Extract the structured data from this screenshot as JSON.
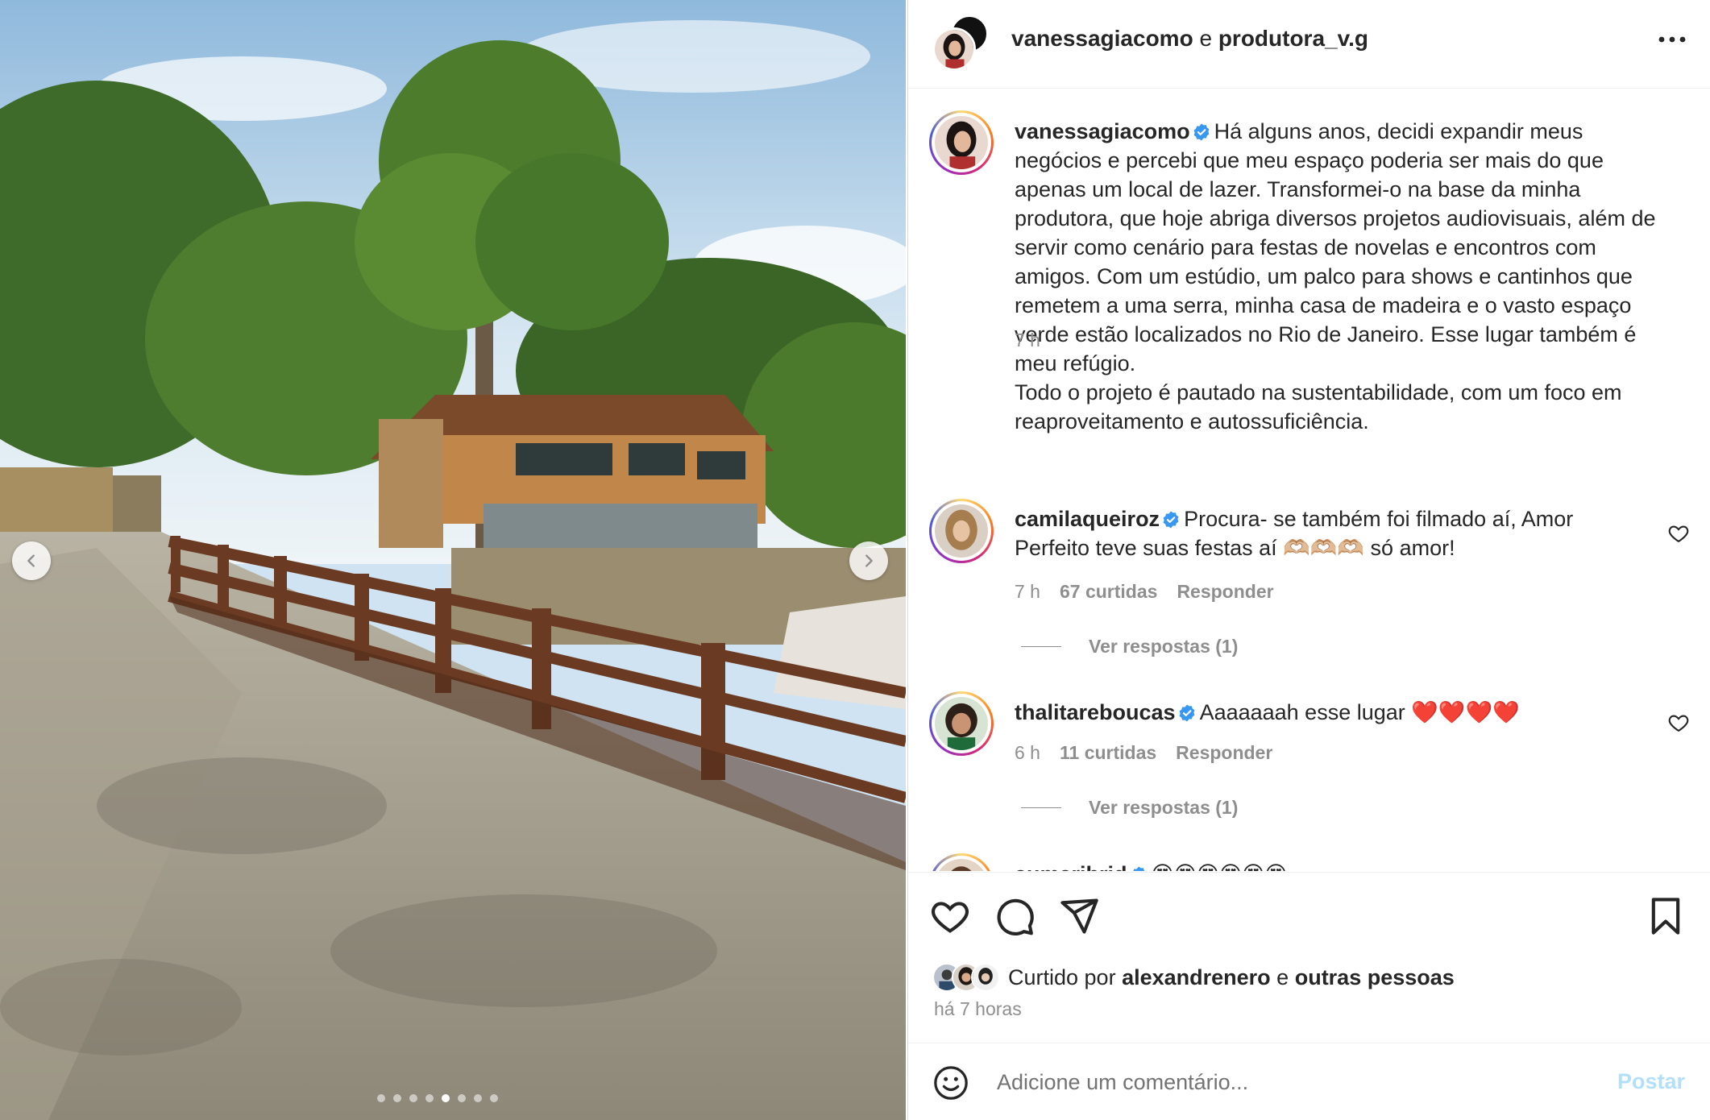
{
  "media": {
    "slide_count": 8,
    "active_slide": 5
  },
  "header": {
    "user1": "vanessagiacomo",
    "connector": " e ",
    "user2": "produtora_v.g"
  },
  "caption": {
    "username": "vanessagiacomo",
    "text": "Há alguns anos, decidi expandir meus negócios e percebi que meu espaço poderia ser mais do que apenas um local de lazer. Transformei-o na base da minha produtora, que hoje abriga diversos projetos audiovisuais, além de servir como cenário para festas de novelas e encontros com amigos. Com um estúdio, um palco para shows e cantinhos que remetem a uma serra, minha casa de madeira e o vasto espaço verde estão localizados no Rio de Janeiro. Esse lugar também é meu refúgio.",
    "text2": "Todo o projeto é pautado na sustentabilidade, com um foco em reaproveitamento e autossuficiência.",
    "time": "7 h"
  },
  "comments": [
    {
      "username": "camilaqueiroz",
      "text_a": "Procura- se também foi filmado aí, Amor Perfeito teve suas festas aí ",
      "emoji": "🫶🏼🫶🏼🫶🏼",
      "text_b": " só amor!",
      "time": "7 h",
      "likes": "67 curtidas",
      "reply": "Responder",
      "view_replies": "Ver respostas (1)"
    },
    {
      "username": "thalitareboucas",
      "text_a": "Aaaaaaah esse lugar ",
      "emoji": "❤️❤️❤️❤️",
      "time": "6 h",
      "likes": "11 curtidas",
      "reply": "Responder",
      "view_replies": "Ver respostas (1)"
    },
    {
      "username": "aumaribrid",
      "emoji": "😍😍😍😍😍😍"
    }
  ],
  "actions": {
    "liked_prefix": "Curtido por ",
    "liked_user": "alexandrenero",
    "liked_mid": " e ",
    "liked_others": "outras pessoas",
    "time_ago": "há 7 horas"
  },
  "compose": {
    "placeholder": "Adicione um comentário...",
    "post_label": "Postar"
  },
  "colors": {
    "verified": "#3897f0",
    "post_disabled": "#b2dffc",
    "muted": "#8e8e8e"
  }
}
